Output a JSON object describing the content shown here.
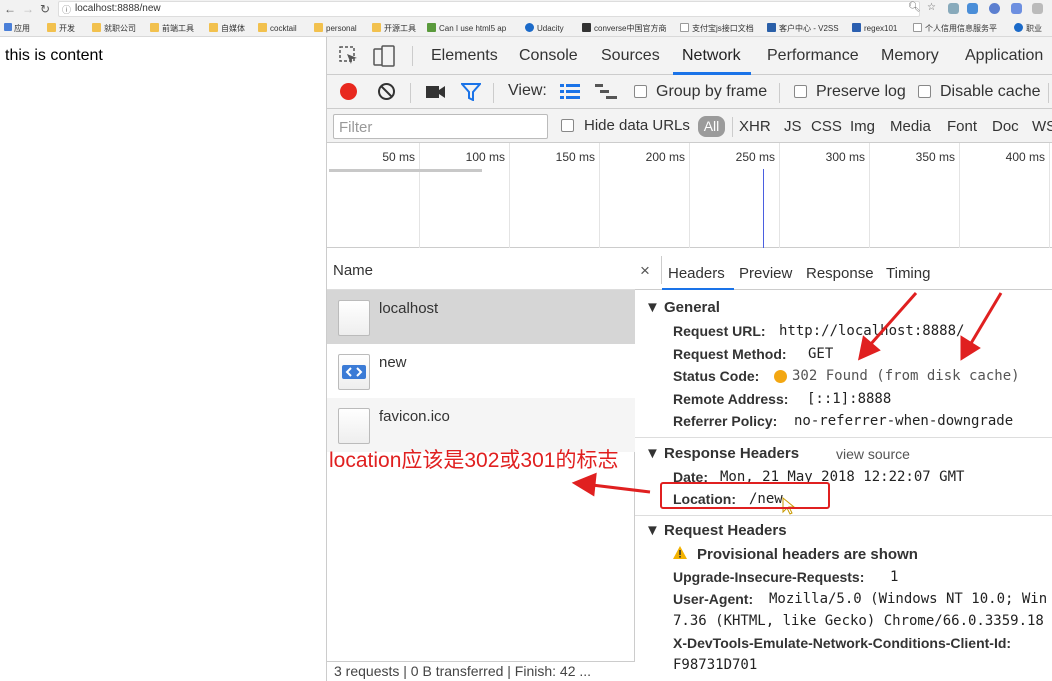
{
  "browser": {
    "url": "localhost:8888/new",
    "bookmarks": [
      "应用",
      "开发",
      "就职公司",
      "前端工具",
      "自媒体",
      "cocktail",
      "personal",
      "开源工具",
      "Can I use html5 ap",
      "Udacity",
      "converse中国官方商",
      "支付宝js接口文档",
      "客户中心 - V2SS",
      "regex101",
      "个人信用信息服务平",
      "职业"
    ]
  },
  "page": {
    "content_text": "this is content"
  },
  "devtools": {
    "tabs": [
      "Elements",
      "Console",
      "Sources",
      "Network",
      "Performance",
      "Memory",
      "Application"
    ],
    "active_tab": "Network",
    "toolbar": {
      "view_label": "View:",
      "group_by_frame": "Group by frame",
      "preserve_log": "Preserve log",
      "disable_cache": "Disable cache"
    },
    "filter": {
      "placeholder": "Filter",
      "hide_data_urls": "Hide data URLs",
      "types": [
        "All",
        "XHR",
        "JS",
        "CSS",
        "Img",
        "Media",
        "Font",
        "Doc",
        "WS"
      ]
    },
    "timeline_ticks": [
      "50 ms",
      "100 ms",
      "150 ms",
      "200 ms",
      "250 ms",
      "300 ms",
      "350 ms",
      "400 ms"
    ],
    "requests": {
      "header": "Name",
      "items": [
        "localhost",
        "new",
        "favicon.ico"
      ],
      "status": "3 requests | 0 B transferred | Finish: 42 ..."
    },
    "details": {
      "tabs": [
        "Headers",
        "Preview",
        "Response",
        "Timing"
      ],
      "general": {
        "title": "General",
        "request_url_k": "Request URL:",
        "request_url_v": "http://localhost:8888/",
        "method_k": "Request Method:",
        "method_v": "GET",
        "status_k": "Status Code:",
        "status_v": "302 Found (from disk cache)",
        "remote_k": "Remote Address:",
        "remote_v": "[::1]:8888",
        "referrer_k": "Referrer Policy:",
        "referrer_v": "no-referrer-when-downgrade"
      },
      "response": {
        "title": "Response Headers",
        "view_source": "view source",
        "date_k": "Date:",
        "date_v": "Mon, 21 May 2018 12:22:07 GMT",
        "location_k": "Location:",
        "location_v": "/new"
      },
      "request": {
        "title": "Request Headers",
        "provisional": "Provisional headers are shown",
        "upgrade_k": "Upgrade-Insecure-Requests:",
        "upgrade_v": "1",
        "ua_k": "User-Agent:",
        "ua_v1": "Mozilla/5.0 (Windows NT 10.0; Win",
        "ua_v2": "7.36 (KHTML, like Gecko) Chrome/66.0.3359.18",
        "emulate_k": "X-DevTools-Emulate-Network-Conditions-Client-Id:",
        "emulate_v": "F98731D701"
      }
    }
  },
  "annotation": {
    "text": "location应该是302或301的标志",
    "color": "#e02020"
  }
}
